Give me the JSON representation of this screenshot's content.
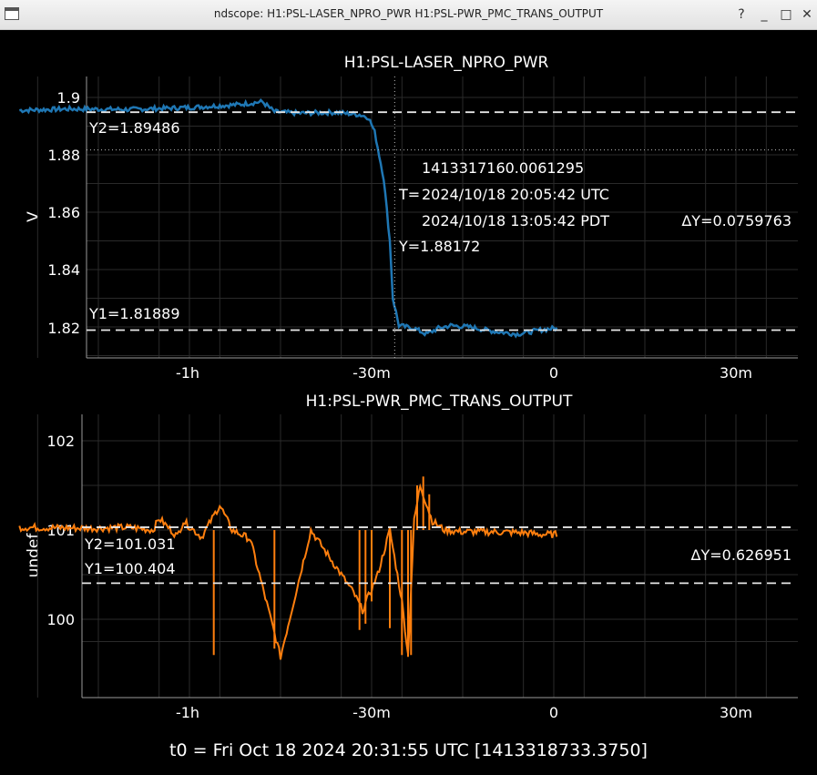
{
  "window": {
    "title": "ndscope: H1:PSL-LASER_NPRO_PWR H1:PSL-PWR_PMC_TRANS_OUTPUT",
    "buttons": [
      "?",
      "_",
      "□",
      "✕"
    ]
  },
  "x_ticks": [
    "-1h",
    "-30m",
    "0",
    "30m"
  ],
  "footer": "t0 = Fri Oct 18 2024 20:31:55 UTC [1413318733.3750]",
  "top": {
    "title": "H1:PSL-LASER_NPRO_PWR",
    "ylabel": "V",
    "y_ticks": [
      "1.9",
      "1.88",
      "1.86",
      "1.84",
      "1.82"
    ],
    "cursor": {
      "gps": "1413317160.0061295",
      "t_prefix": "T=",
      "utc": "2024/10/18 20:05:42 UTC",
      "pdt": "2024/10/18 13:05:42 PDT",
      "y": "Y=1.88172"
    },
    "y2_label": "Y2=1.89486",
    "y1_label": "Y1=1.81889",
    "dy_label": "ΔY=0.0759763",
    "color": "#1f77b4"
  },
  "bottom": {
    "title": "H1:PSL-PWR_PMC_TRANS_OUTPUT",
    "ylabel": "undef",
    "y_ticks": [
      "102",
      "101",
      "100"
    ],
    "y2_label": "Y2=101.031",
    "y1_label": "Y1=100.404",
    "dy_label": "ΔY=0.626951",
    "color": "#ff7f0e"
  },
  "chart_data": [
    {
      "type": "line",
      "title": "H1:PSL-LASER_NPRO_PWR",
      "ylabel": "V",
      "xlabel": "",
      "xlim": [
        -88,
        45
      ],
      "ylim": [
        1.8095,
        1.9045
      ],
      "x_ticks": [
        "-1h",
        "-30m",
        "0",
        "30m"
      ],
      "y_ticks": [
        1.9,
        1.88,
        1.86,
        1.84,
        1.82
      ],
      "series": [
        {
          "x": [
            -88,
            -80,
            -70,
            -60,
            -52,
            -48,
            -46,
            -42,
            -36,
            -32,
            -30.5,
            -29.5,
            -28,
            -27,
            -26.5,
            -25.5,
            -23,
            -21,
            -19,
            -17,
            -14,
            -10,
            -6,
            -2,
            0
          ],
          "y": [
            1.8955,
            1.896,
            1.8958,
            1.8965,
            1.8975,
            1.8985,
            1.895,
            1.8945,
            1.8948,
            1.894,
            1.893,
            1.888,
            1.8717,
            1.85,
            1.83,
            1.8205,
            1.8195,
            1.8175,
            1.8195,
            1.8205,
            1.82,
            1.8185,
            1.8175,
            1.819,
            1.8195
          ]
        }
      ],
      "cursors": {
        "T": "2024/10/18 20:05:42 UTC",
        "Y": 1.88172,
        "Y1": 1.81889,
        "Y2": 1.89486,
        "dY": 0.0759763
      }
    },
    {
      "type": "line",
      "title": "H1:PSL-PWR_PMC_TRANS_OUTPUT",
      "ylabel": "undef",
      "xlabel": "",
      "xlim": [
        -88,
        45
      ],
      "ylim": [
        99.57,
        102.12
      ],
      "x_ticks": [
        "-1h",
        "-30m",
        "0",
        "30m"
      ],
      "y_ticks": [
        102,
        101,
        100
      ],
      "series": [
        {
          "x": [
            -88,
            -76,
            -70,
            -66,
            -65,
            -62,
            -61,
            -58,
            -55,
            -53,
            -50,
            -45,
            -40,
            -33,
            -31.5,
            -29,
            -27,
            -25,
            -24,
            -23,
            -22,
            -21.5,
            -20,
            -18,
            -15,
            -10,
            -5,
            -2,
            0
          ],
          "y": [
            101.03,
            101.02,
            101.03,
            101.0,
            101.13,
            100.93,
            101.1,
            100.92,
            101.28,
            101.0,
            100.9,
            99.58,
            101.0,
            100.3,
            100.1,
            100.5,
            101.0,
            100.2,
            99.6,
            101.1,
            101.5,
            101.4,
            101.1,
            101.0,
            100.98,
            100.98,
            100.97,
            100.95,
            100.95
          ]
        }
      ],
      "cursors": {
        "Y1": 100.404,
        "Y2": 101.031,
        "dY": 0.626951
      }
    }
  ]
}
